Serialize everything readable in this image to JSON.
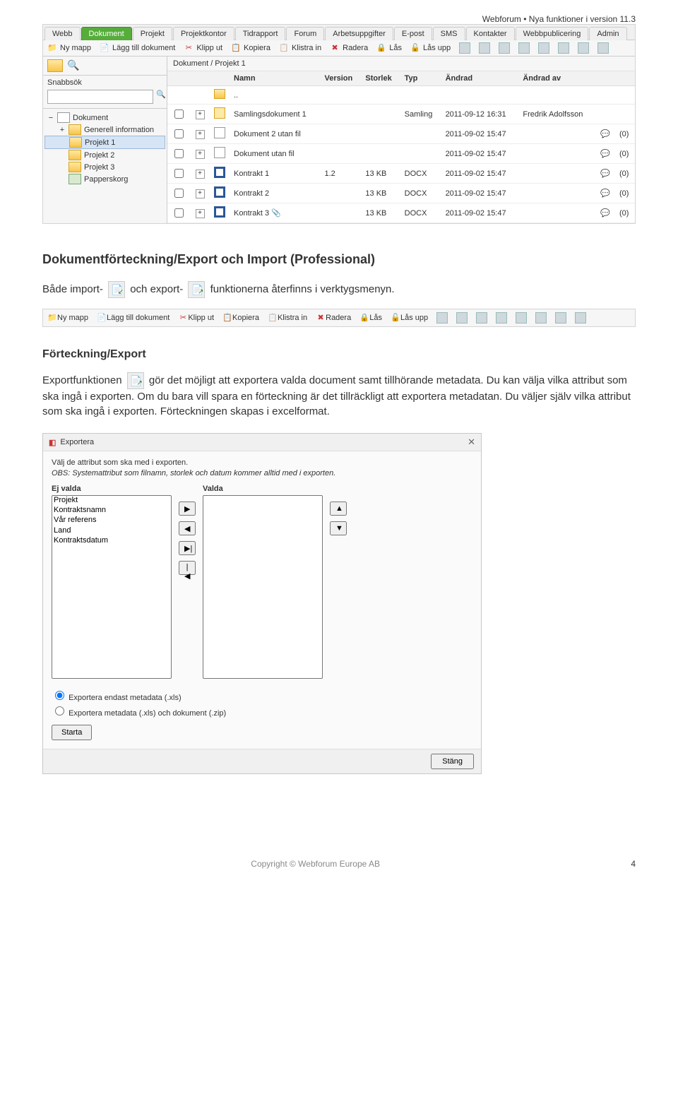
{
  "header_right": "Webforum • Nya funktioner i version 11.3",
  "app": {
    "tabs": [
      "Webb",
      "Dokument",
      "Projekt",
      "Projektkontor",
      "Tidrapport",
      "Forum",
      "Arbetsuppgifter",
      "E-post",
      "SMS",
      "Kontakter",
      "Webbpublicering",
      "Admin"
    ],
    "active_tab": "Dokument",
    "toolbar": {
      "ny_mapp": "Ny mapp",
      "lagg_till": "Lägg till dokument",
      "klipp_ut": "Klipp ut",
      "kopiera": "Kopiera",
      "klistra_in": "Klistra in",
      "radera": "Radera",
      "las": "Lås",
      "las_upp": "Lås upp"
    },
    "side": {
      "quick_label": "Snabbsök",
      "tree": {
        "root": "Dokument",
        "items": [
          "Generell information",
          "Projekt 1",
          "Projekt 2",
          "Projekt 3",
          "Papperskorg"
        ]
      }
    },
    "main": {
      "breadcrumb": "Dokument / Projekt 1",
      "cols": {
        "namn": "Namn",
        "version": "Version",
        "storlek": "Storlek",
        "typ": "Typ",
        "andrad": "Ändrad",
        "andrad_av": "Ändrad av"
      },
      "up_label": "..",
      "rows": [
        {
          "name": "Samlingsdokument 1",
          "ver": "",
          "size": "",
          "typ": "Samling",
          "andrad": "2011-09-12 16:31",
          "av": "Fredrik Adolfsson",
          "cm": "",
          "ic": "coll"
        },
        {
          "name": "Dokument 2 utan fil",
          "ver": "",
          "size": "",
          "typ": "",
          "andrad": "2011-09-02 15:47",
          "av": "",
          "cm": "(0)",
          "ic": "doc"
        },
        {
          "name": "Dokument utan fil",
          "ver": "",
          "size": "",
          "typ": "",
          "andrad": "2011-09-02 15:47",
          "av": "",
          "cm": "(0)",
          "ic": "doc"
        },
        {
          "name": "Kontrakt 1",
          "ver": "1.2",
          "size": "13 KB",
          "typ": "DOCX",
          "andrad": "2011-09-02 15:47",
          "av": "",
          "cm": "(0)",
          "ic": "word"
        },
        {
          "name": "Kontrakt 2",
          "ver": "",
          "size": "13 KB",
          "typ": "DOCX",
          "andrad": "2011-09-02 15:47",
          "av": "",
          "cm": "(0)",
          "ic": "word"
        },
        {
          "name": "Kontrakt 3 📎",
          "ver": "",
          "size": "13 KB",
          "typ": "DOCX",
          "andrad": "2011-09-02 15:47",
          "av": "",
          "cm": "(0)",
          "ic": "word"
        }
      ]
    }
  },
  "doc": {
    "h1": "Dokumentförteckning/Export och Import (Professional)",
    "p1a": "Både import- ",
    "p1b": " och export- ",
    "p1c": " funktionerna återfinns i verktygsmenyn.",
    "h2": "Förteckning/Export",
    "p2a": "Exportfunktionen ",
    "p2b": " gör det möjligt att exportera valda document samt tillhörande metadata. Du kan välja vilka attribut som ska ingå i exporten. Om du bara vill spara en förteckning är det tillräckligt att exportera metadatan. Du väljer själv vilka attribut som ska ingå i exporten. Förteckningen skapas i excelformat."
  },
  "dialog": {
    "title": "Exportera",
    "instr": "Välj de attribut som ska med i exporten.",
    "obs": "OBS: Systemattribut som filnamn, storlek och datum kommer alltid med i exporten.",
    "col_unsel": "Ej valda",
    "col_sel": "Valda",
    "unsel_items": [
      "Projekt",
      "Kontraktsnamn",
      "Vår referens",
      "Land",
      "Kontraktsdatum"
    ],
    "radio1": "Exportera endast metadata (.xls)",
    "radio2": "Exportera metadata (.xls) och dokument (.zip)",
    "start": "Starta",
    "close": "Stäng"
  },
  "footer": {
    "copyright": "Copyright © Webforum Europe AB",
    "page": "4"
  }
}
